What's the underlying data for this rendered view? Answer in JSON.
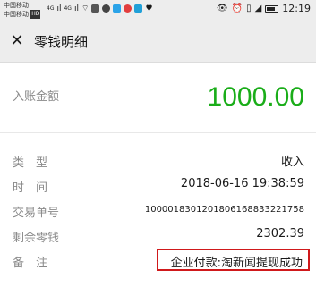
{
  "status": {
    "carrier1": "中国移动",
    "carrier2": "中国移动",
    "network": "HD",
    "signal1": "4G",
    "signal2": "4G",
    "time": "12:19"
  },
  "header": {
    "close_icon": "close-icon",
    "title": "零钱明细"
  },
  "amount": {
    "label": "入账金额",
    "value": "1000.00",
    "color": "#1aad19"
  },
  "details": [
    {
      "label": "类　型",
      "value": "收入"
    },
    {
      "label": "时　间",
      "value": "2018-06-16 19:38:59"
    },
    {
      "label": "交易单号",
      "value": "1000018301201806168833221758"
    },
    {
      "label": "剩余零钱",
      "value": "2302.39"
    },
    {
      "label": "备　注",
      "value": "企业付款:淘新闻提现成功",
      "highlight_color": "#d0191b"
    }
  ]
}
